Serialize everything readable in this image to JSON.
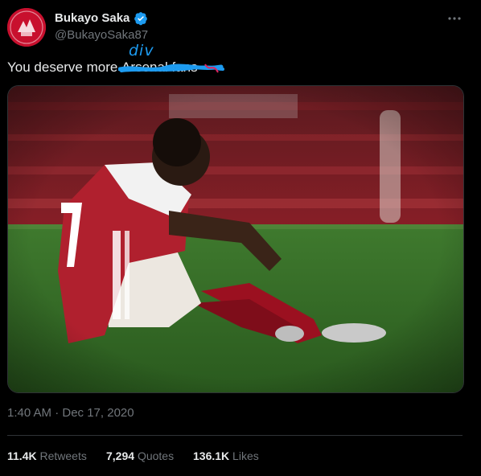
{
  "author": {
    "display_name": "Bukayo Saka",
    "handle": "@BukayoSaka87",
    "verified": true,
    "avatar_color": "#c8102e"
  },
  "tweet": {
    "text_before": "You deserve more ",
    "struck_text": "Arsenal fans",
    "handwritten_correction": "div",
    "image_alt": "Arsenal player sitting on the pitch with head bowed"
  },
  "meta": {
    "timestamp": "1:40 AM · Dec 17, 2020"
  },
  "stats": {
    "retweets_count": "11.4K",
    "retweets_label": "Retweets",
    "quotes_count": "7,294",
    "quotes_label": "Quotes",
    "likes_count": "136.1K",
    "likes_label": "Likes"
  },
  "colors": {
    "background": "#000000",
    "text_primary": "#e7e9ea",
    "text_secondary": "#71767b",
    "accent_blue": "#1d9bf0",
    "divider": "#2f3336"
  }
}
